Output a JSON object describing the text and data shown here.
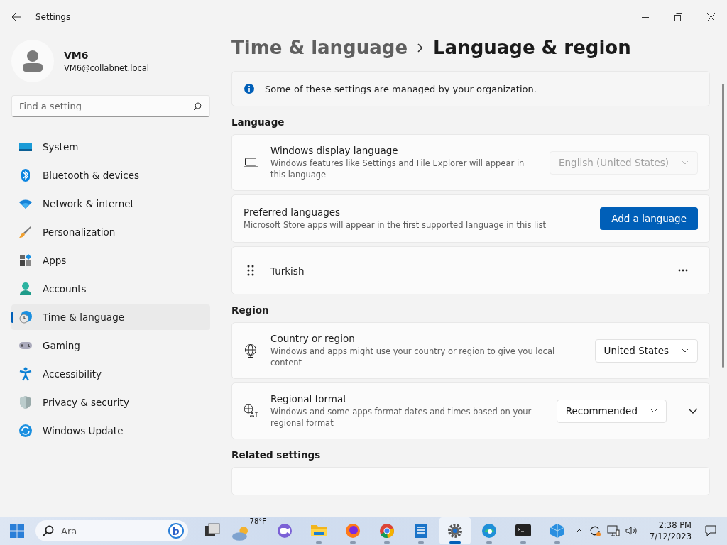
{
  "window": {
    "title": "Settings"
  },
  "user": {
    "name": "VM6",
    "email": "VM6@collabnet.local"
  },
  "search": {
    "placeholder": "Find a setting"
  },
  "nav": [
    {
      "label": "System",
      "selected": false
    },
    {
      "label": "Bluetooth & devices",
      "selected": false
    },
    {
      "label": "Network & internet",
      "selected": false
    },
    {
      "label": "Personalization",
      "selected": false
    },
    {
      "label": "Apps",
      "selected": false
    },
    {
      "label": "Accounts",
      "selected": false
    },
    {
      "label": "Time & language",
      "selected": true
    },
    {
      "label": "Gaming",
      "selected": false
    },
    {
      "label": "Accessibility",
      "selected": false
    },
    {
      "label": "Privacy & security",
      "selected": false
    },
    {
      "label": "Windows Update",
      "selected": false
    }
  ],
  "breadcrumb": {
    "parent": "Time & language",
    "current": "Language & region"
  },
  "info_banner": "Some of these settings are managed by your organization.",
  "sections": [
    {
      "title": "Language",
      "rows": [
        {
          "kind": "dropdown",
          "title": "Windows display language",
          "description": "Windows features like Settings and File Explorer will appear in this language",
          "value": "English (United States)",
          "disabled": true
        },
        {
          "kind": "button",
          "title": "Preferred languages",
          "description": "Microsoft Store apps will appear in the first supported language in this list",
          "button": "Add a language"
        },
        {
          "kind": "language",
          "title": "Turkish"
        }
      ]
    },
    {
      "title": "Region",
      "rows": [
        {
          "kind": "dropdown",
          "title": "Country or region",
          "description": "Windows and apps might use your country or region to give you local content",
          "value": "United States",
          "disabled": false
        },
        {
          "kind": "dropdown",
          "title": "Regional format",
          "description": "Windows and some apps format dates and times based on your regional format",
          "value": "Recommended",
          "disabled": false,
          "expanded": false
        }
      ]
    },
    {
      "title": "Related settings",
      "rows": [
        {
          "kind": "blank"
        }
      ]
    }
  ],
  "taskbar": {
    "search_placeholder": "Ara",
    "apps": [
      {
        "kind": "app",
        "running": false,
        "selected": false
      },
      {
        "kind": "weather",
        "label": "78°F",
        "running": false,
        "selected": false
      },
      {
        "kind": "app",
        "running": false,
        "selected": false
      },
      {
        "kind": "app",
        "running": true,
        "selected": false
      },
      {
        "kind": "app",
        "running": true,
        "selected": false
      },
      {
        "kind": "app",
        "running": true,
        "selected": false
      },
      {
        "kind": "app",
        "running": true,
        "selected": false
      },
      {
        "kind": "app",
        "running": true,
        "selected": true
      },
      {
        "kind": "app",
        "running": true,
        "selected": false
      },
      {
        "kind": "app",
        "running": true,
        "selected": false
      },
      {
        "kind": "app",
        "running": true,
        "selected": false
      }
    ],
    "time": "2:38 PM",
    "date": "7/12/2023"
  }
}
